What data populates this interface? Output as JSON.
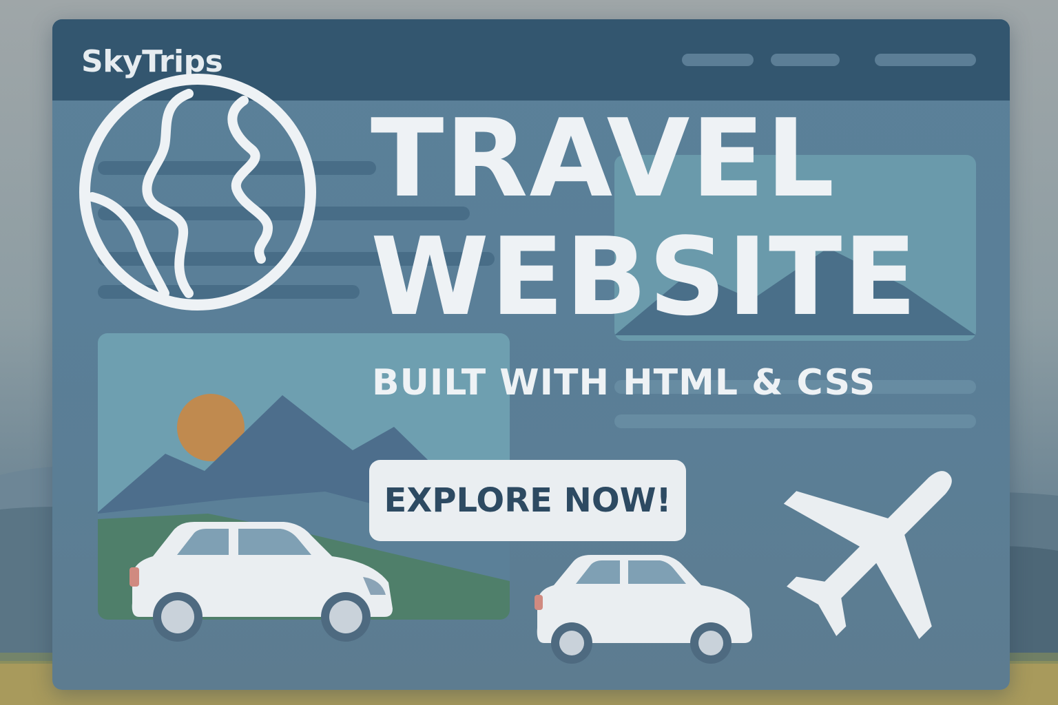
{
  "app": {
    "logo_text": "SkyTrips"
  },
  "nav": {
    "items": [
      {
        "icon": "nav-placeholder"
      },
      {
        "icon": "nav-placeholder"
      },
      {
        "icon": "nav-placeholder"
      }
    ]
  },
  "hero": {
    "title_line1": "TRAVEL",
    "title_line2": "WEBSITE",
    "subtitle": "BUILT WITH HTML & CSS",
    "cta_label": "EXPLORE NOW!"
  },
  "icons": {
    "globe": "globe-icon",
    "airplane": "airplane-icon",
    "car": "car-icon",
    "mountain": "mountain-icon",
    "sun": "sun-icon"
  },
  "colors": {
    "header": "#33566f",
    "panel": "#5b8099",
    "text": "#eef2f5",
    "cta_text": "#2d4a62",
    "sun": "#c08a4f",
    "meadow": "#4f7f6a"
  }
}
